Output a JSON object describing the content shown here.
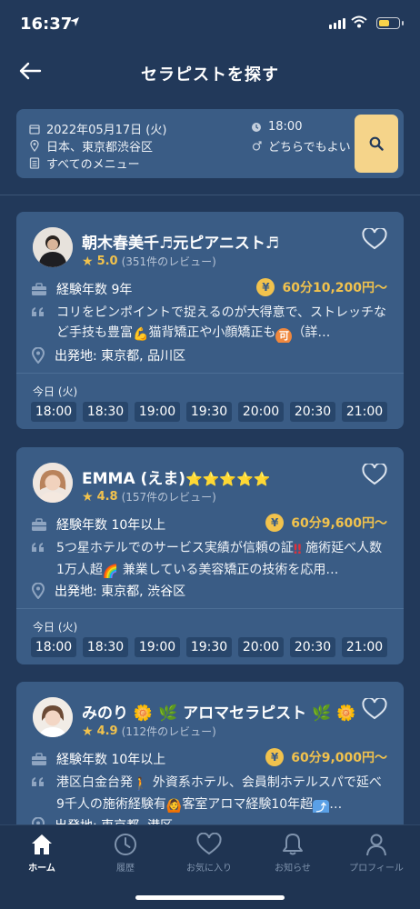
{
  "status_bar": {
    "time": "16:37"
  },
  "header": {
    "title": "セラピストを探す"
  },
  "search": {
    "date": "2022年05月17日 (火)",
    "time": "18:00",
    "location": "日本、東京都渋谷区",
    "gender": "どちらでもよい",
    "menu": "すべてのメニュー"
  },
  "therapists": [
    {
      "name": "朝木春美千♬元ピアニスト♬",
      "rating": "5.0",
      "reviews": "(351件のレビュー)",
      "experience": "経験年数 9年",
      "price": "60分10,200円〜",
      "desc_1": "コリをピンポイントで捉えるのが大得意で、ストレッチなど手技も豊富",
      "desc_emoji_1": "💪",
      "desc_2": "猫背矯正や小顔矯正も",
      "desc_badge": "可",
      "desc_3": "（詳…",
      "location": "出発地: 東京都, 品川区",
      "today": "今日 (火)",
      "slots": [
        "18:00",
        "18:30",
        "19:00",
        "19:30",
        "20:00",
        "20:30",
        "21:00"
      ]
    },
    {
      "name": "EMMA (えま)",
      "name_suffix": "⭐⭐⭐⭐⭐",
      "rating": "4.8",
      "reviews": "(157件のレビュー)",
      "experience": "経験年数 10年以上",
      "price": "60分9,600円〜",
      "desc_1": "5つ星ホテルでのサービス実績が信頼の証",
      "desc_emoji_1": "‼",
      "desc_2": "施術延べ人数1万人超",
      "desc_emoji_2": "🌈",
      "desc_3": "兼業している美容矯正の技術を応用…",
      "location": "出発地: 東京都, 渋谷区",
      "today": "今日 (火)",
      "slots": [
        "18:00",
        "18:30",
        "19:00",
        "19:30",
        "20:00",
        "20:30",
        "21:00"
      ]
    },
    {
      "name": "みのり",
      "name_mid": "🌼 🌿",
      "name_2": "アロマセラピスト",
      "name_suffix": "🌿 🌼",
      "rating": "4.9",
      "reviews": "(112件のレビュー)",
      "experience": "経験年数 10年以上",
      "price": "60分9,000円〜",
      "desc_1": "港区白金台発",
      "desc_emoji_1": "🚶",
      "desc_2": "外資系ホテル、会員制ホテルスパで延べ9千人の施術経験有",
      "desc_emoji_2": "🙆",
      "desc_3": "客室アロマ経験10年超",
      "desc_badge": "⤴",
      "desc_4": "…",
      "location": "出発地: 東京都, 港区"
    }
  ],
  "tabbar": {
    "items": [
      {
        "label": "ホーム",
        "icon": "home-icon"
      },
      {
        "label": "履歴",
        "icon": "clock-icon"
      },
      {
        "label": "お気に入り",
        "icon": "heart-icon"
      },
      {
        "label": "お知らせ",
        "icon": "bell-icon"
      },
      {
        "label": "プロフィール",
        "icon": "person-icon"
      }
    ]
  },
  "colors": {
    "background": "#22395a",
    "card": "#3a5c85",
    "accent": "#f1c24d",
    "search_button": "#f5d48a"
  }
}
